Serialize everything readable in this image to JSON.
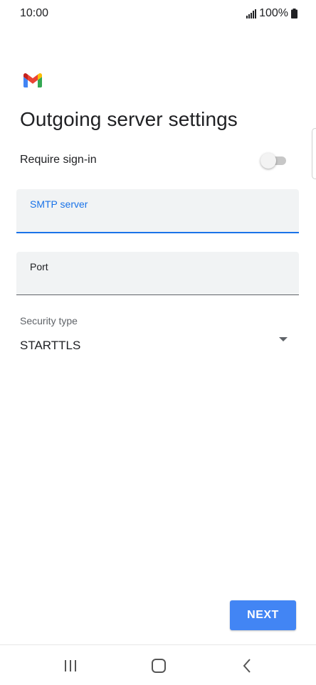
{
  "status_bar": {
    "time": "10:00",
    "battery": "100%"
  },
  "screen": {
    "title": "Outgoing server settings"
  },
  "require_sign_in": {
    "label": "Require sign-in",
    "checked": false
  },
  "smtp_server": {
    "label": "SMTP server",
    "value": "",
    "focused": true
  },
  "port": {
    "label": "Port",
    "value": ""
  },
  "security_type": {
    "label": "Security type",
    "selected": "STARTTLS"
  },
  "actions": {
    "next_label": "NEXT"
  },
  "colors": {
    "accent": "#1a73e8",
    "button": "#4285f4"
  }
}
